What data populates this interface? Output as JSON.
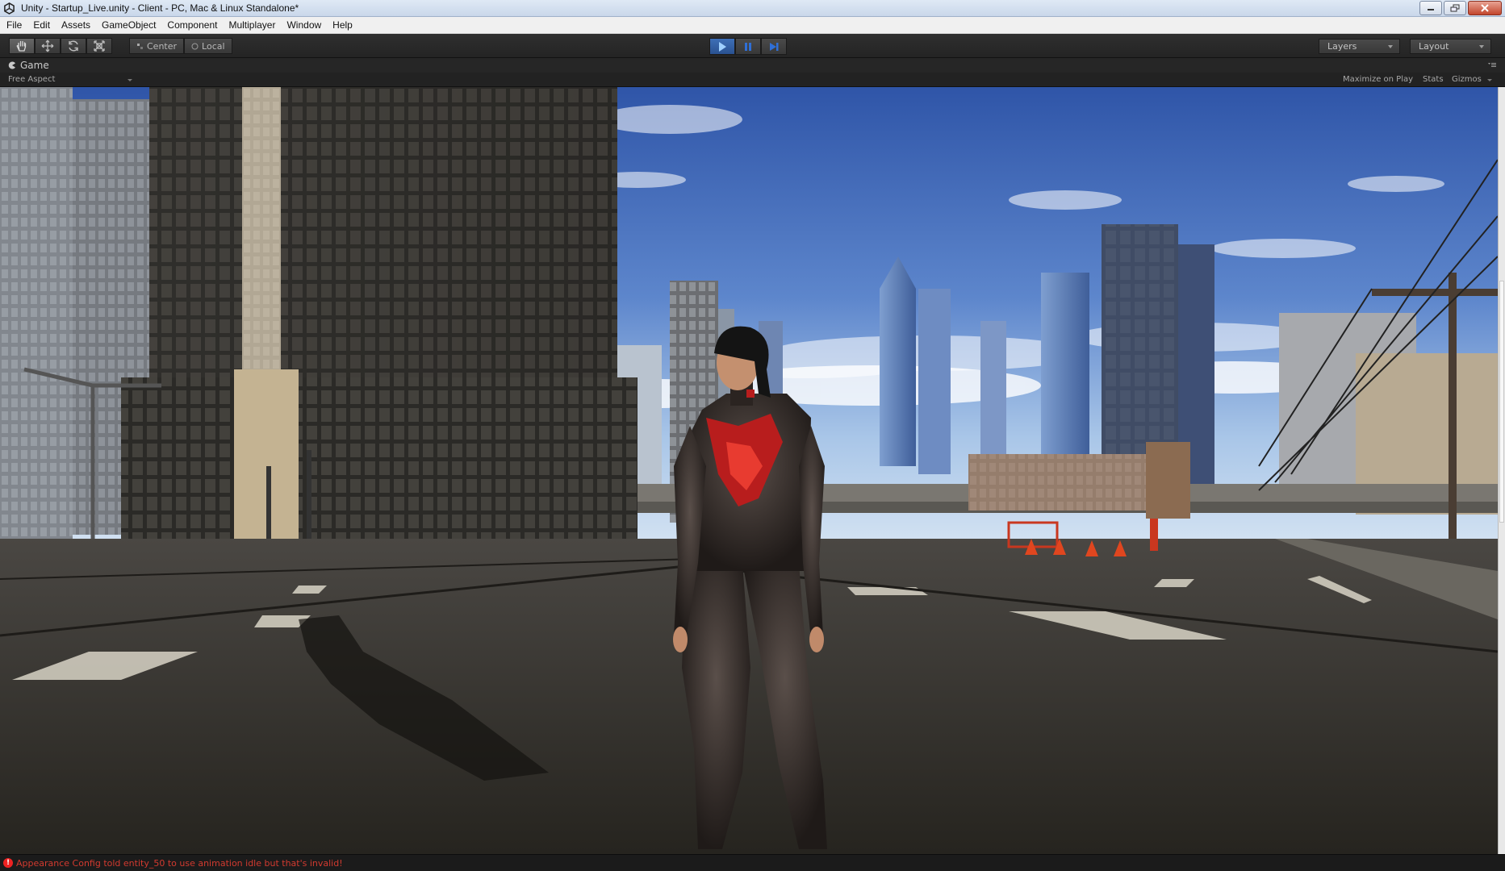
{
  "window": {
    "title": "Unity - Startup_Live.unity - Client - PC, Mac & Linux Standalone*"
  },
  "menu": {
    "items": [
      "File",
      "Edit",
      "Assets",
      "GameObject",
      "Component",
      "Multiplayer",
      "Window",
      "Help"
    ]
  },
  "toolbar": {
    "tools": [
      "hand-tool-icon",
      "move-tool-icon",
      "rotate-tool-icon",
      "scale-tool-icon"
    ],
    "pivot_mode": "Center",
    "pivot_rotation": "Local",
    "play_controls": [
      "play-icon",
      "pause-icon",
      "step-icon"
    ],
    "layers_label": "Layers",
    "layout_label": "Layout"
  },
  "game_view": {
    "tab_label": "Game",
    "aspect": "Free Aspect",
    "maximize_on_play": "Maximize on Play",
    "stats": "Stats",
    "gizmos": "Gizmos"
  },
  "status": {
    "message": "Appearance Config told entity_50 to use animation idle but that's invalid!",
    "color": "#d23a2f"
  },
  "colors": {
    "accent_play": "#3e6fb7",
    "sky_top": "#3d62b5",
    "sky_bottom": "#a9c6e8"
  }
}
